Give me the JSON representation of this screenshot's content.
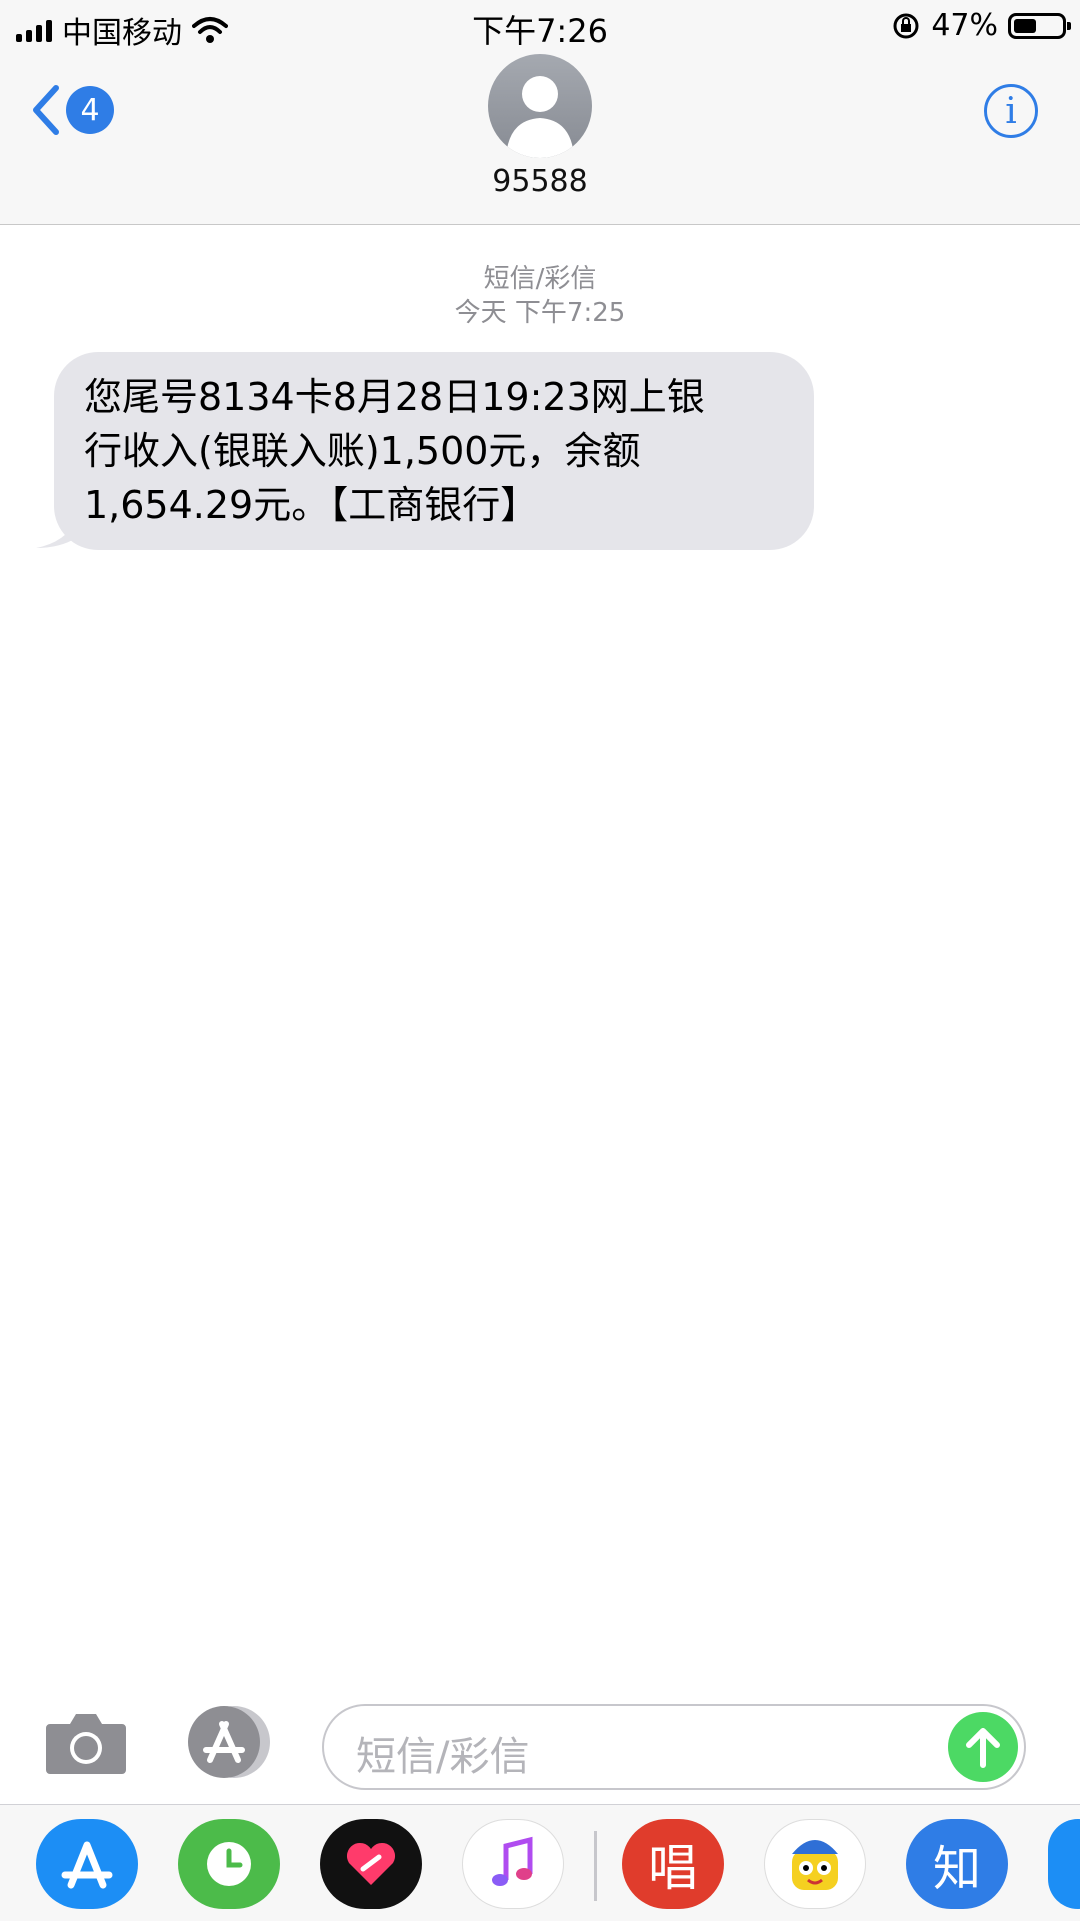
{
  "status_bar": {
    "carrier": "中国移动",
    "time": "下午7:26",
    "battery_percent": "47%",
    "battery_level": 0.47,
    "icons": [
      "signal-icon",
      "wifi-icon",
      "rotation-lock-icon",
      "battery-icon"
    ]
  },
  "nav": {
    "back_badge": "4",
    "contact_name": "95588",
    "info_label": "i"
  },
  "thread": {
    "type_label": "短信/彩信",
    "timestamp": "今天 下午7:25"
  },
  "messages": [
    {
      "line1": "您尾号8134卡8月28日19:23网上银",
      "line2": "行收入(银联入账)1,500元，余额",
      "line3": "1,654.29元。【工商银行】"
    }
  ],
  "composer": {
    "placeholder": "短信/彩信"
  },
  "app_drawer": {
    "apps": [
      "app-store-icon",
      "clock-app-icon",
      "heart-app-icon",
      "music-app-icon",
      "sing-app-icon",
      "sticker-app-icon",
      "zhihu-app-icon"
    ],
    "sing_label": "唱",
    "zhihu_label": "知"
  },
  "colors": {
    "accent": "#2f7de6",
    "bubble": "#e5e5ea",
    "send": "#4cd964"
  }
}
